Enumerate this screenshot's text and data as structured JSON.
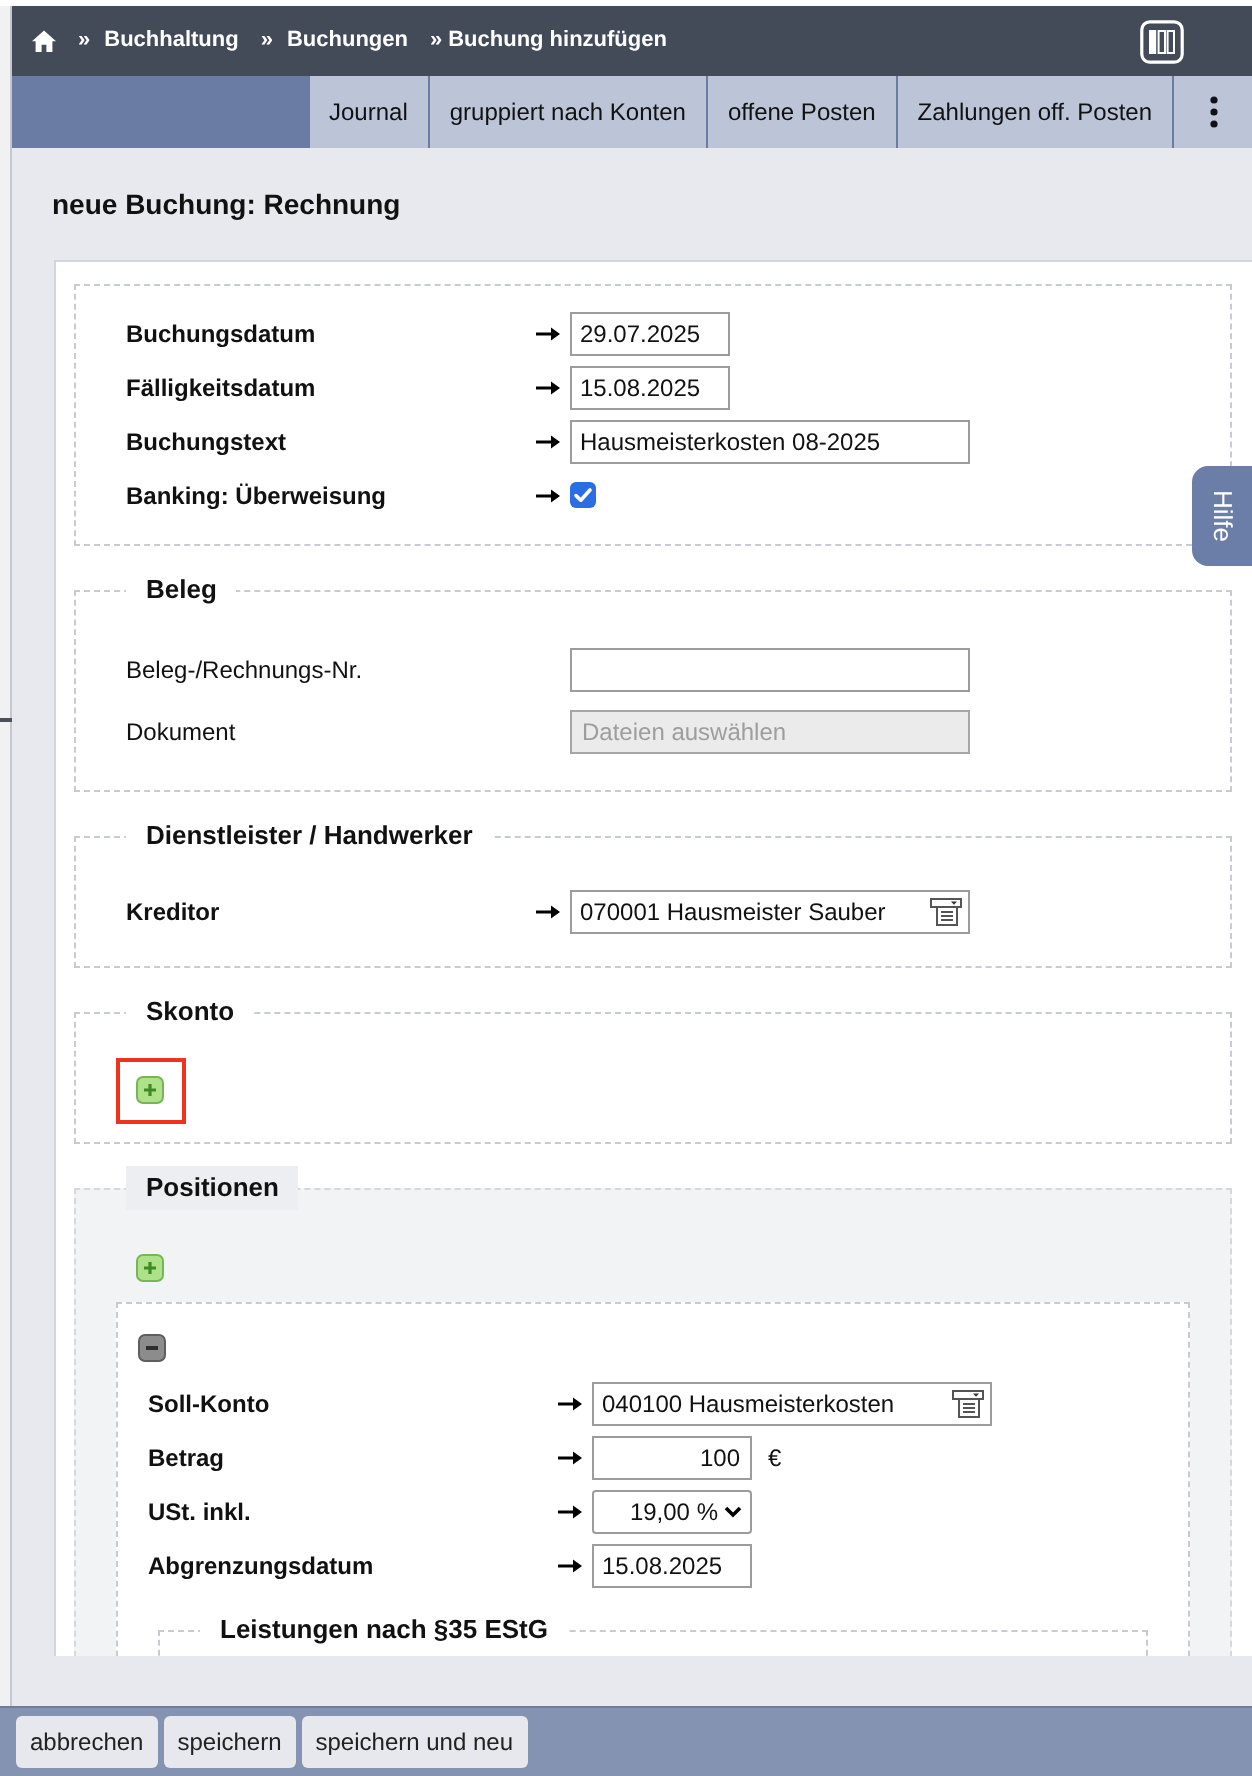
{
  "breadcrumb": [
    {
      "separator": "»",
      "label": "Buchhaltung"
    },
    {
      "separator": "»",
      "label": "Buchungen"
    },
    {
      "separator": "»",
      "label": "Buchung hinzufügen"
    }
  ],
  "tabs": [
    {
      "label": "Journal"
    },
    {
      "label": "gruppiert nach Konten"
    },
    {
      "label": "offene Posten"
    },
    {
      "label": "Zahlungen off. Posten"
    }
  ],
  "page_title": "neue Buchung: Rechnung",
  "sections": [
    {
      "kind": "plain",
      "fields": [
        {
          "kind": "date",
          "label": "Buchungsdatum",
          "emphasized": true,
          "value": "29.07.2025"
        },
        {
          "kind": "date",
          "label": "Fälligkeitsdatum",
          "emphasized": true,
          "value": "15.08.2025"
        },
        {
          "kind": "text",
          "label": "Buchungstext",
          "emphasized": true,
          "value": "Hausmeisterkosten 08-2025"
        },
        {
          "kind": "checkbox",
          "label": "Banking: Überweisung",
          "emphasized": true,
          "checked": true
        }
      ]
    },
    {
      "kind": "fieldset",
      "legend": "Beleg",
      "fields": [
        {
          "kind": "text",
          "label": "Beleg-/Rechnungs-Nr.",
          "emphasized": false
        },
        {
          "kind": "file",
          "label": "Dokument",
          "emphasized": false,
          "button": "Dateien auswählen",
          "disabled": true
        }
      ]
    },
    {
      "kind": "fieldset",
      "legend": "Dienstleister / Handwerker",
      "fields": [
        {
          "kind": "lookup",
          "label": "Kreditor",
          "emphasized": true,
          "value": "070001 Hausmeister Sauber"
        }
      ]
    },
    {
      "kind": "fieldset",
      "legend": "Skonto",
      "add_button": {
        "annotated": true
      }
    },
    {
      "kind": "positions",
      "legend": "Positionen",
      "add_button": {
        "annotated": false
      },
      "positions": [
        {
          "fields": [
            {
              "kind": "lookup",
              "label": "Soll-Konto",
              "emphasized": true,
              "value": "040100 Hausmeisterkosten"
            },
            {
              "kind": "amount",
              "label": "Betrag",
              "emphasized": true,
              "value": "100",
              "unit": "€"
            },
            {
              "kind": "select",
              "label": "USt. inkl.",
              "emphasized": true,
              "value": "19,00 %"
            },
            {
              "kind": "date",
              "label": "Abgrenzungsdatum",
              "emphasized": true,
              "value": "15.08.2025"
            }
          ],
          "subsections": [
            {
              "legend": "Leistungen nach §35 EStG"
            }
          ]
        }
      ]
    }
  ],
  "help_tab": {
    "label": "Hilfe"
  },
  "footer_buttons": [
    {
      "label": "abbrechen"
    },
    {
      "label": "speichern"
    },
    {
      "label": "speichern und neu"
    }
  ]
}
